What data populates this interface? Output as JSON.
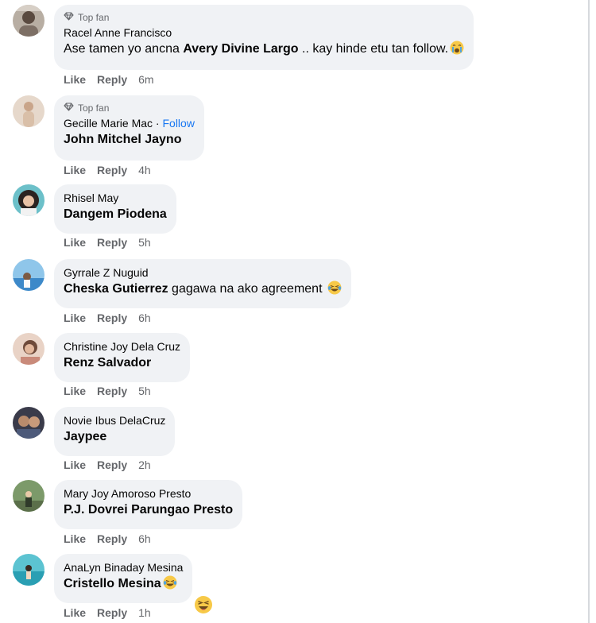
{
  "comments": [
    {
      "badge": "Top fan",
      "author": "Racel Anne Francisco",
      "text_before": "Ase tamen yo ancna ",
      "tag": "Avery Divine Largo",
      "text_after": " .. kay hinde etu tan follow.",
      "emoji": "crying-face-emoji-icon",
      "like": "Like",
      "reply": "Reply",
      "time": "6m"
    },
    {
      "badge": "Top fan",
      "author": "Gecille Marie Mac",
      "separator": " · ",
      "follow": "Follow",
      "tag": "John Mitchel Jayno",
      "like": "Like",
      "reply": "Reply",
      "time": "4h"
    },
    {
      "author": "Rhisel May",
      "tag": "Dangem Piodena",
      "like": "Like",
      "reply": "Reply",
      "time": "5h"
    },
    {
      "author": "Gyrrale Z Nuguid",
      "tag": "Cheska Gutierrez",
      "text_after": " gagawa na ako agreement ",
      "emoji": "laughing-tears-emoji-icon",
      "like": "Like",
      "reply": "Reply",
      "time": "6h"
    },
    {
      "author": "Christine Joy Dela Cruz",
      "tag": "Renz Salvador",
      "like": "Like",
      "reply": "Reply",
      "time": "5h"
    },
    {
      "author": "Novie Ibus DelaCruz",
      "tag": "Jaypee",
      "like": "Like",
      "reply": "Reply",
      "time": "2h"
    },
    {
      "author": "Mary Joy Amoroso Presto",
      "tag": "P.J. Dovrei Parungao Presto",
      "like": "Like",
      "reply": "Reply",
      "time": "6h"
    },
    {
      "author": "AnaLyn Binaday Mesina",
      "tag": "Cristello Mesina",
      "emoji": "laughing-tears-emoji-icon",
      "reaction": "haha-reaction-icon",
      "like": "Like",
      "reply": "Reply",
      "time": "1h"
    }
  ],
  "colors": {
    "bubble": "#f0f2f5",
    "muted": "#65676b",
    "follow": "#1877f2",
    "text": "#050505"
  }
}
